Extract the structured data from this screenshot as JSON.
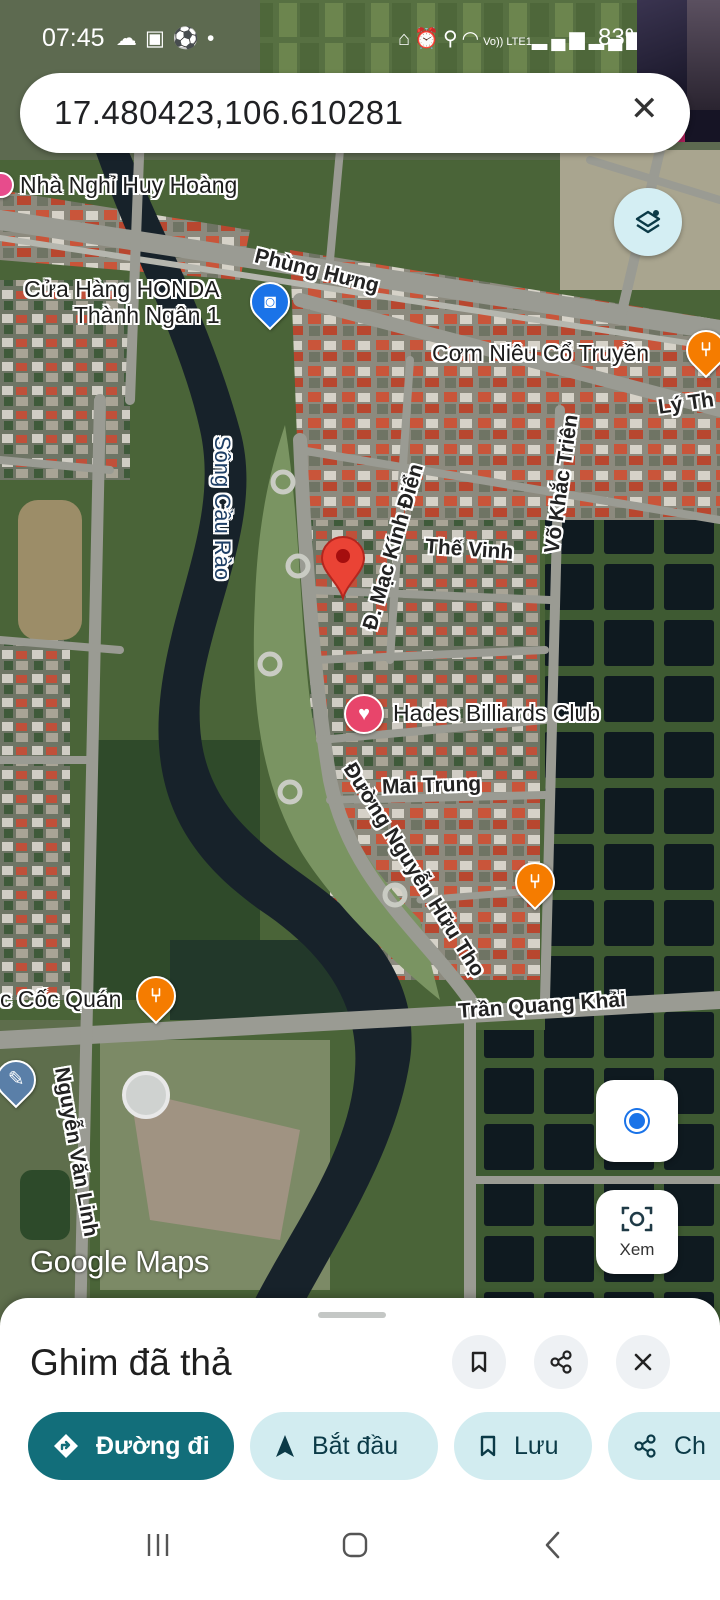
{
  "status_bar": {
    "time": "07:45",
    "left_icons": [
      "cloud-icon",
      "image-icon",
      "soccer-ball-icon",
      "dot-icon"
    ],
    "right_icons": [
      "lock-icon",
      "alarm-icon",
      "location-icon",
      "wifi-icon",
      "volte-icon",
      "signal-icon",
      "signal-icon"
    ],
    "volte_label": "Vo)) LTE1",
    "battery": "83%"
  },
  "search": {
    "query": "17.480423,106.610281",
    "close_label": "✕"
  },
  "map": {
    "labels": {
      "nha_nghi": "Nhà Nghỉ Huy Hoàng",
      "phung_hung": "Phùng Hưng",
      "cua_hang": "Cửa Hàng HONDA\nThành Ngân 1",
      "com_nieu": "Cơm Niêu Cổ Truyền",
      "ly_th": "Lý Th",
      "song_cau_rao": "Sông Cầu Rào",
      "mac_kinh_dien": "Đ. Mạc Kính Điển",
      "vo_khac_trien": "Võ Khắc Triên",
      "the_vinh": "Thế Vinh",
      "hades": "Hades Billiards Club",
      "mai_trung": "Mai Trung",
      "nguyen_huu_tho": "Đường Nguyễn Hữu Thọ",
      "coc_quan": "c Cốc Quán",
      "tran_quang_khai": "Trần Quang Khải",
      "nguyen_van_linh": "Nguyễn Văn Linh"
    },
    "pin_color": "#ea4335",
    "accent_color": "#1a73e8",
    "food_color": "#f57c00",
    "attribution": "Google Maps"
  },
  "controls": {
    "lens_label": "Xem"
  },
  "sheet": {
    "title": "Ghim đã thả",
    "chips": {
      "directions": "Đường đi",
      "start": "Bắt đầu",
      "save": "Lưu",
      "share": "Ch"
    },
    "primary_color": "#126e7a",
    "chip_color": "#d2ecf0"
  }
}
